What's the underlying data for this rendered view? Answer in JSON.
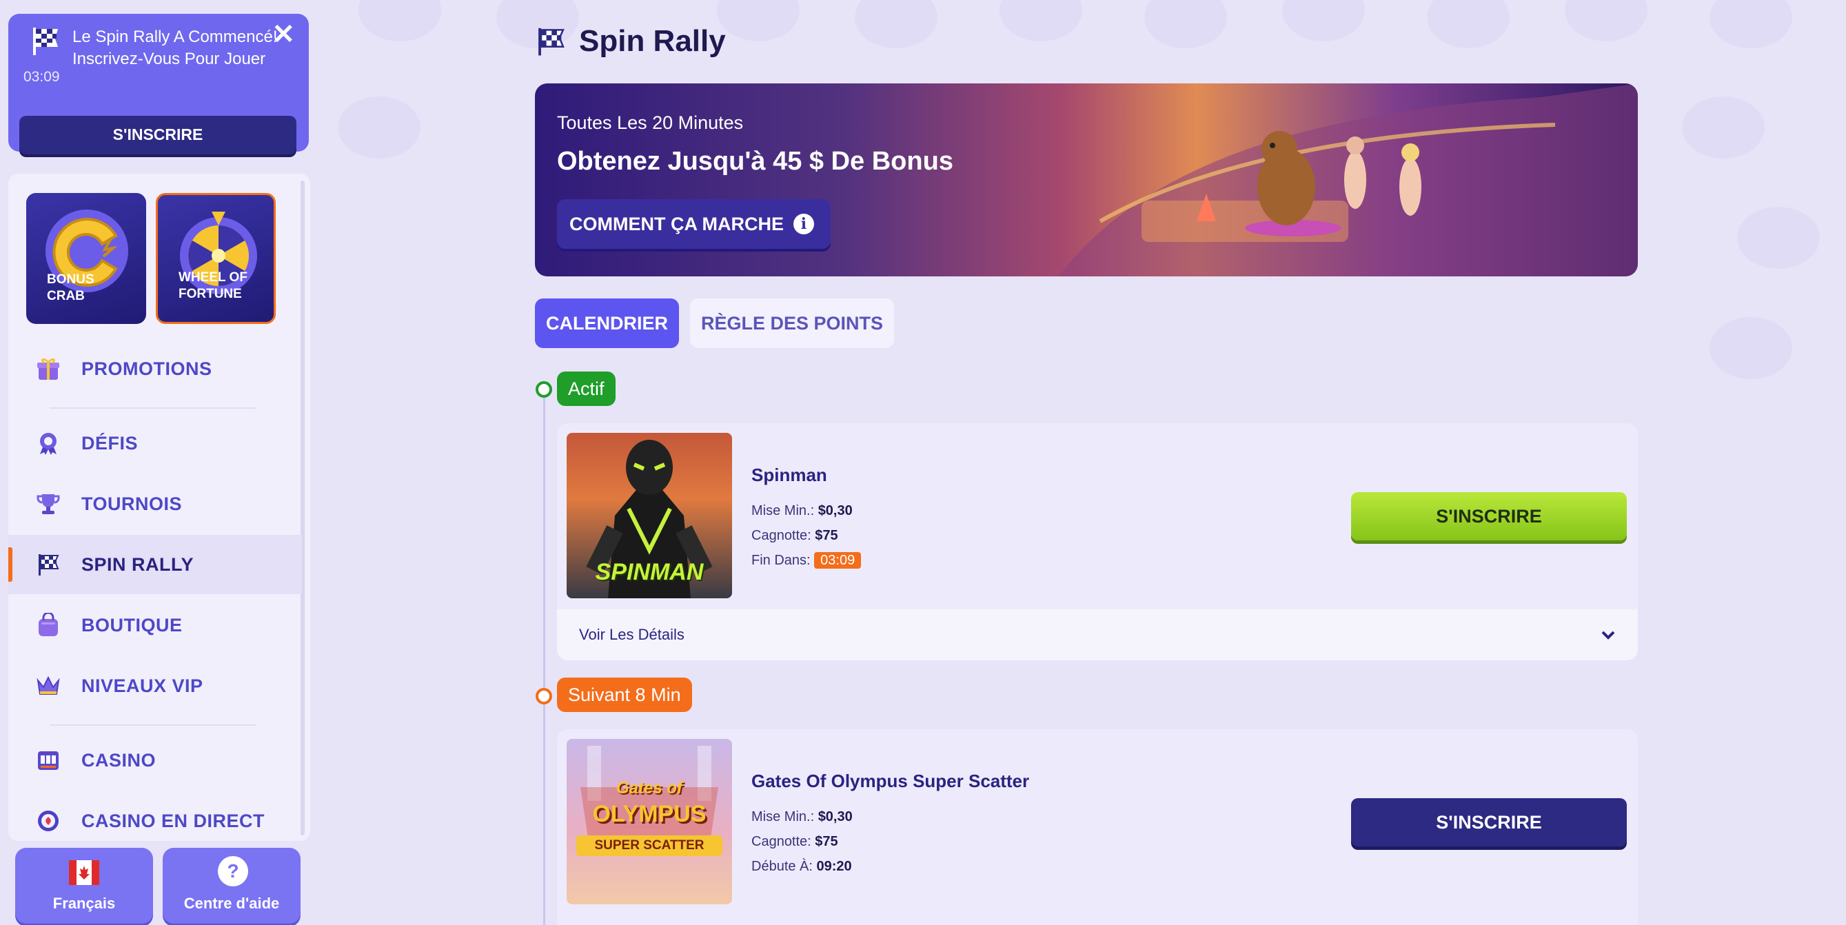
{
  "notification": {
    "message": "Le Spin Rally A Commencé! Inscrivez-Vous Pour Jouer",
    "timer": "03:09",
    "button": "S'INSCRIRE"
  },
  "tiles": [
    {
      "label_line1": "BONUS",
      "label_line2": "CRAB"
    },
    {
      "label_line1": "WHEEL OF",
      "label_line2": "FORTUNE"
    }
  ],
  "nav": [
    {
      "label": "PROMOTIONS",
      "icon": "gift-icon"
    },
    {
      "label": "DÉFIS",
      "icon": "medal-icon"
    },
    {
      "label": "TOURNOIS",
      "icon": "trophy-icon"
    },
    {
      "label": "SPIN RALLY",
      "icon": "checkered-flag-icon",
      "active": true
    },
    {
      "label": "BOUTIQUE",
      "icon": "bag-icon"
    },
    {
      "label": "NIVEAUX VIP",
      "icon": "crown-icon"
    },
    {
      "label": "CASINO",
      "icon": "slot-machine-icon"
    },
    {
      "label": "CASINO EN DIRECT",
      "icon": "poker-chip-icon"
    }
  ],
  "footer": {
    "language": "Français",
    "help": "Centre d'aide",
    "help_icon_glyph": "?"
  },
  "page": {
    "title": "Spin Rally"
  },
  "banner": {
    "subtitle": "Toutes Les 20 Minutes",
    "headline": "Obtenez Jusqu'à 45 $ De Bonus",
    "how_button": "COMMENT ÇA MARCHE",
    "info_glyph": "i"
  },
  "tabs": [
    {
      "label": "CALENDRIER",
      "active": true
    },
    {
      "label": "RÈGLE DES POINTS",
      "active": false
    }
  ],
  "timeline": [
    {
      "status": "Actif",
      "status_color": "#1f9e2a",
      "game": "Spinman",
      "min_bet_label": "Mise Min.:",
      "min_bet": "$0,30",
      "jackpot_label": "Cagnotte:",
      "jackpot": "$75",
      "time_label": "Fin Dans:",
      "time": "03:09",
      "button": "S'INSCRIRE",
      "details": "Voir Les Détails",
      "thumb_text": "SPINMAN"
    },
    {
      "status": "Suivant 8 Min",
      "status_color": "#f46d1b",
      "game": "Gates Of Olympus Super Scatter",
      "min_bet_label": "Mise Min.:",
      "min_bet": "$0,30",
      "jackpot_label": "Cagnotte:",
      "jackpot": "$75",
      "time_label": "Débute À:",
      "time": "09:20",
      "button": "S'INSCRIRE",
      "thumb_text_1": "Gates of",
      "thumb_text_2": "OLYMPUS",
      "thumb_text_3": "SUPER SCATTER"
    }
  ],
  "colors": {
    "accent": "#5d55ef",
    "active_bar": "#f46d1b",
    "navy": "#2d2a83",
    "green_cta": "#9fd42a"
  }
}
